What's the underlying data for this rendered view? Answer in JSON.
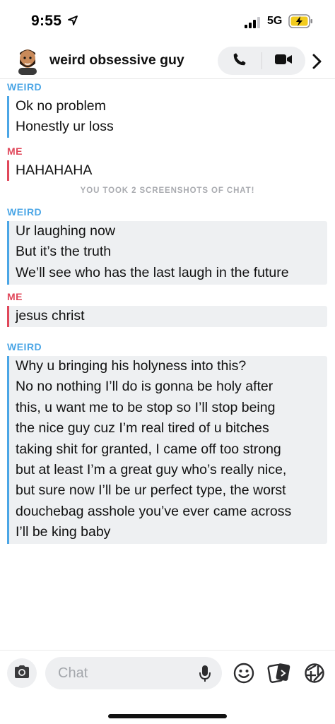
{
  "status_bar": {
    "time": "9:55",
    "network": "5G"
  },
  "header": {
    "contact_name": "weird obsessive guy"
  },
  "conversation": [
    {
      "sender": "WEIRD",
      "type": "friend",
      "lines": [
        "Ok no problem",
        "Honestly ur loss"
      ]
    },
    {
      "sender": "ME",
      "type": "me",
      "lines": [
        "HAHAHAHA"
      ]
    },
    {
      "sender": "WEIRD",
      "type": "friend",
      "lines": [
        "Ur laughing now",
        "But it’s the truth",
        "We’ll see who has the last laugh in the future"
      ]
    },
    {
      "sender": "ME",
      "type": "me",
      "lines": [
        "jesus christ"
      ]
    },
    {
      "sender": "WEIRD",
      "type": "friend",
      "lines": [
        "Why u bringing his holyness into this?",
        "No no nothing I’ll do is gonna be holy after",
        "this, u want me to be stop so I’ll stop being",
        "the nice guy cuz I’m real tired of u bitches",
        "taking shit for granted, I came off too strong",
        "but at least I’m a great guy who’s really nice,",
        "but sure now I’ll be ur perfect type, the worst",
        "douchebag asshole you’ve ever came across",
        "I’ll be king baby"
      ]
    }
  ],
  "screenshot_notice": "YOU TOOK 2 SCREENSHOTS OF CHAT!",
  "composer": {
    "placeholder": "Chat"
  },
  "colors": {
    "friend_accent": "#4ba6e6",
    "me_accent": "#e0475a",
    "bubble_bg": "#eef0f2",
    "notice_text": "#a9abb0"
  },
  "icons": [
    "location-arrow-icon",
    "signal-icon",
    "battery-charging-icon",
    "bitmoji-avatar",
    "phone-icon",
    "video-camera-icon",
    "chevron-right-icon",
    "camera-icon",
    "microphone-icon",
    "emoji-icon",
    "cards-icon",
    "lens-icon"
  ]
}
